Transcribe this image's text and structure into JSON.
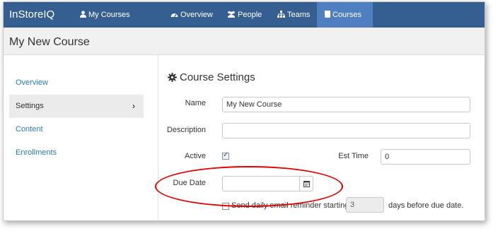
{
  "navbar": {
    "brand": "InStoreIQ",
    "my_courses": "My Courses",
    "overview": "Overview",
    "people": "People",
    "teams": "Teams",
    "courses": "Courses",
    "active_color": "#4f7fc0",
    "bar_color": "#365f91"
  },
  "page": {
    "title": "My New Course"
  },
  "sidebar": {
    "items": [
      {
        "label": "Overview"
      },
      {
        "label": "Settings"
      },
      {
        "label": "Content"
      },
      {
        "label": "Enrollments"
      }
    ]
  },
  "settings": {
    "title": "Course Settings",
    "name_label": "Name",
    "name_value": "My New Course",
    "description_label": "Description",
    "description_value": "",
    "active_label": "Active",
    "active_checked": true,
    "est_time_label": "Est Time",
    "est_time_value": "0",
    "due_date_label": "Due Date",
    "due_date_value": "",
    "reminder_text": "Send daily email reminder starting",
    "reminder_checked": false,
    "reminder_days": "3",
    "days_text": "days before due date."
  }
}
